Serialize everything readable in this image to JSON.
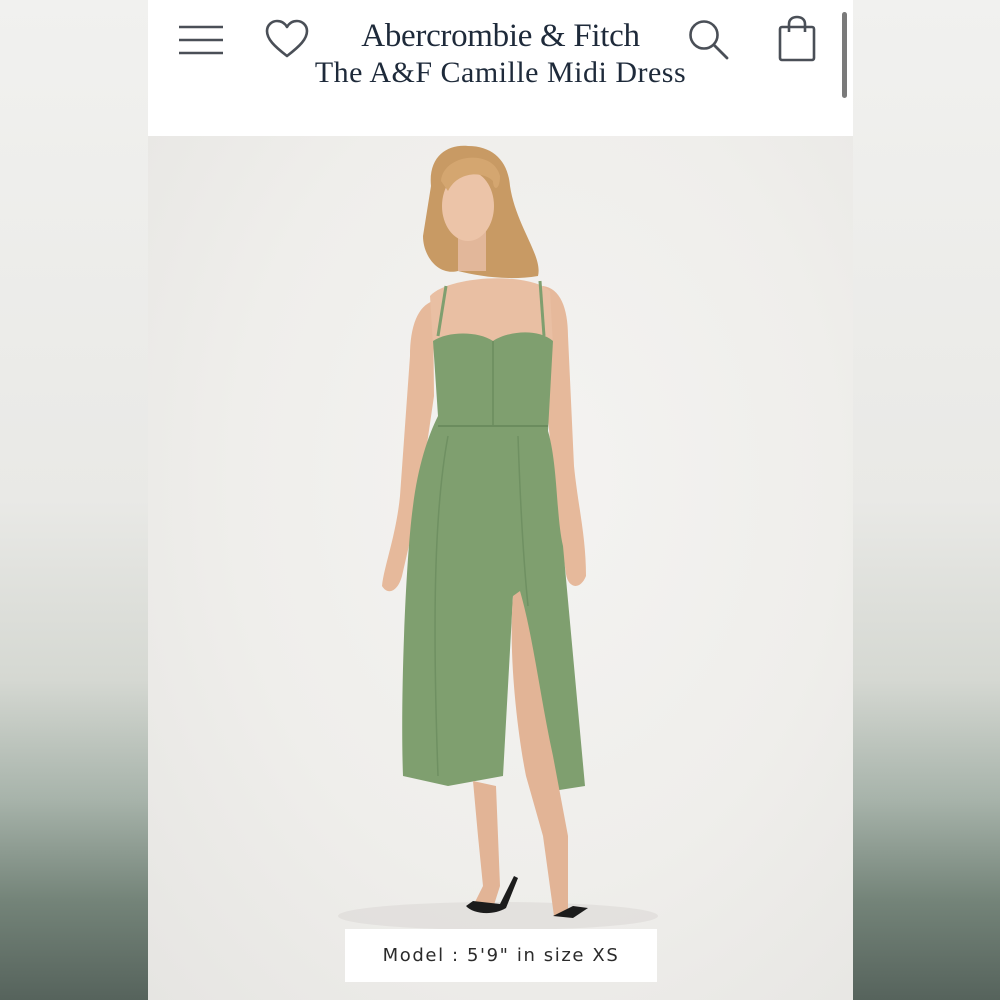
{
  "header": {
    "brand": "Abercrombie & Fitch",
    "product_title": "The A&F Camille Midi Dress",
    "icons": [
      "menu-icon",
      "heart-icon",
      "search-icon",
      "shopping-bag-icon"
    ]
  },
  "product_image": {
    "caption": "Model : 5'9\" in size XS"
  },
  "colors": {
    "brand_navy": "#1e2a3a",
    "dress_green": "#7f9f6f",
    "background": "#efeeeb"
  }
}
